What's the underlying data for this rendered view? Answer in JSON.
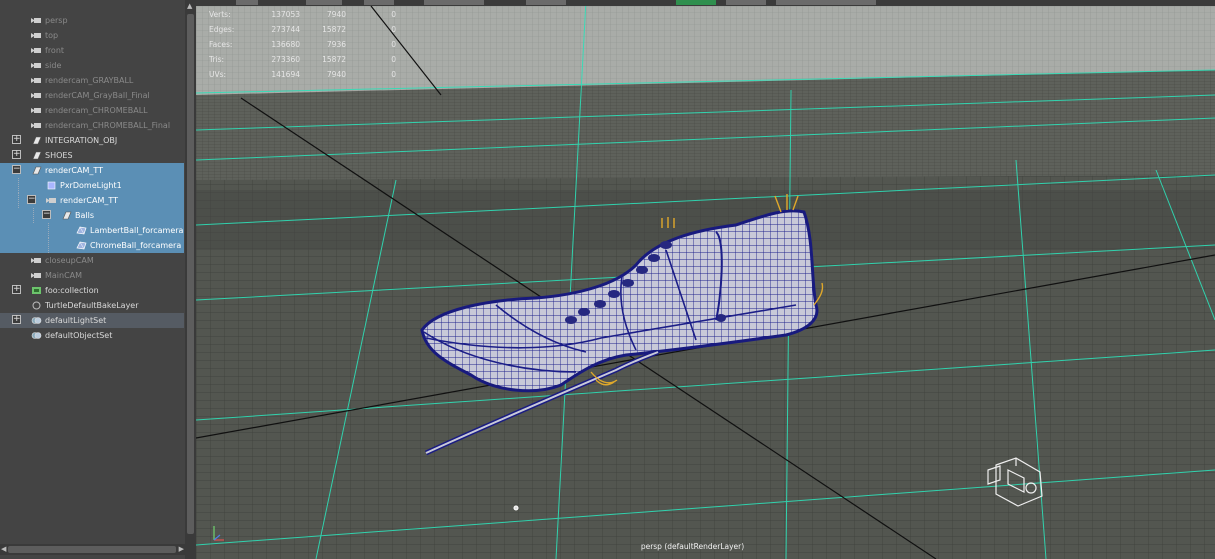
{
  "outliner": {
    "items": [
      {
        "label": "persp",
        "icon": "camera-icon",
        "indent": 0,
        "expand": "",
        "state": "dim"
      },
      {
        "label": "top",
        "icon": "camera-icon",
        "indent": 0,
        "expand": "",
        "state": "dim"
      },
      {
        "label": "front",
        "icon": "camera-icon",
        "indent": 0,
        "expand": "",
        "state": "dim"
      },
      {
        "label": "side",
        "icon": "camera-icon",
        "indent": 0,
        "expand": "",
        "state": "dim"
      },
      {
        "label": "rendercam_GRAYBALL",
        "icon": "camera-icon",
        "indent": 0,
        "expand": "",
        "state": "dim"
      },
      {
        "label": "renderCAM_GrayBall_Final",
        "icon": "camera-icon",
        "indent": 0,
        "expand": "",
        "state": "dim"
      },
      {
        "label": "rendercam_CHROMEBALL",
        "icon": "camera-icon",
        "indent": 0,
        "expand": "",
        "state": "dim"
      },
      {
        "label": "rendercam_CHROMEBALL_Final",
        "icon": "camera-icon",
        "indent": 0,
        "expand": "",
        "state": "dim"
      },
      {
        "label": "INTEGRATION_OBJ",
        "icon": "group-icon",
        "indent": 0,
        "expand": "+",
        "state": ""
      },
      {
        "label": "SHOES",
        "icon": "group-icon",
        "indent": 0,
        "expand": "+",
        "state": ""
      },
      {
        "label": "renderCAM_TT",
        "icon": "group-icon",
        "indent": 0,
        "expand": "−",
        "state": "sel"
      },
      {
        "label": "PxrDomeLight1",
        "icon": "light-icon",
        "indent": 1,
        "expand": "",
        "state": "sel"
      },
      {
        "label": "renderCAM_TT",
        "icon": "camera-icon",
        "indent": 1,
        "expand": "−",
        "state": "sel"
      },
      {
        "label": "Balls",
        "icon": "group-icon",
        "indent": 2,
        "expand": "−",
        "state": "sel"
      },
      {
        "label": "LambertBall_forcamera",
        "icon": "mesh-icon",
        "indent": 3,
        "expand": "",
        "state": "sel"
      },
      {
        "label": "ChromeBall_forcamera",
        "icon": "mesh-icon",
        "indent": 3,
        "expand": "",
        "state": "sel"
      },
      {
        "label": "closeupCAM",
        "icon": "camera-icon",
        "indent": 0,
        "expand": "",
        "state": "dim"
      },
      {
        "label": "MainCAM",
        "icon": "camera-icon",
        "indent": 0,
        "expand": "",
        "state": "dim"
      },
      {
        "label": "foo:collection",
        "icon": "collection-icon",
        "indent": 0,
        "expand": "+",
        "state": ""
      },
      {
        "label": "TurtleDefaultBakeLayer",
        "icon": "bake-layer-icon",
        "indent": 0,
        "expand": "",
        "state": ""
      },
      {
        "label": "defaultLightSet",
        "icon": "set-icon",
        "indent": 0,
        "expand": "+",
        "state": "hl"
      },
      {
        "label": "defaultObjectSet",
        "icon": "set-icon",
        "indent": 0,
        "expand": "",
        "state": ""
      }
    ]
  },
  "hud": {
    "rows": [
      {
        "label": "Verts:",
        "c1": "137053",
        "c2": "7940",
        "c3": "0"
      },
      {
        "label": "Edges:",
        "c1": "273744",
        "c2": "15872",
        "c3": "0"
      },
      {
        "label": "Faces:",
        "c1": "136680",
        "c2": "7936",
        "c3": "0"
      },
      {
        "label": "Tris:",
        "c1": "273360",
        "c2": "15872",
        "c3": "0"
      },
      {
        "label": "UVs:",
        "c1": "141694",
        "c2": "7940",
        "c3": "0"
      }
    ]
  },
  "viewport": {
    "camera_label": "persp (defaultRenderLayer)"
  },
  "colors": {
    "selection": "#5b8fb5",
    "grid": "#2ee0b8",
    "wireframe": "#1c1d8a",
    "mesh": "#c7c8d6",
    "outliner_bg": "#444444"
  }
}
